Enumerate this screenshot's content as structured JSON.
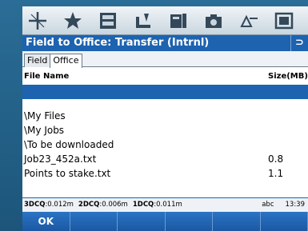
{
  "toolbar": {
    "icons": [
      "crosshair-icon",
      "star-icon",
      "instrument-icon",
      "survey-icon",
      "map-icon",
      "camera-icon",
      "interface-icon",
      "settings-icon"
    ]
  },
  "window": {
    "title": "Field to Office: Transfer (Intrnl)",
    "back_label": "⊃"
  },
  "tabs": [
    {
      "label": "Field",
      "active": false
    },
    {
      "label": "Office",
      "active": true
    }
  ],
  "file_list": {
    "col_name": "File Name",
    "col_size": "Size(MB)",
    "rows": [
      {
        "name": "",
        "size": ""
      },
      {
        "name": "\\My Files",
        "size": ""
      },
      {
        "name": "\\My Jobs",
        "size": ""
      },
      {
        "name": "\\To be downloaded",
        "size": ""
      },
      {
        "name": "Job23_452a.txt",
        "size": "0.8"
      },
      {
        "name": "Points to stake.txt",
        "size": "1.1"
      }
    ]
  },
  "status": {
    "q3_label": "3DCQ",
    "q3_value": ":0.012m",
    "q2_label": "2DCQ",
    "q2_value": ":0.006m",
    "q1_label": "1DCQ",
    "q1_value": ":0.011m",
    "input_mode": "abc",
    "time": "13:39"
  },
  "softkeys": [
    "OK",
    "",
    "",
    "",
    "",
    ""
  ],
  "colors": {
    "accent": "#1d63b0",
    "device": "#1f5f86"
  }
}
